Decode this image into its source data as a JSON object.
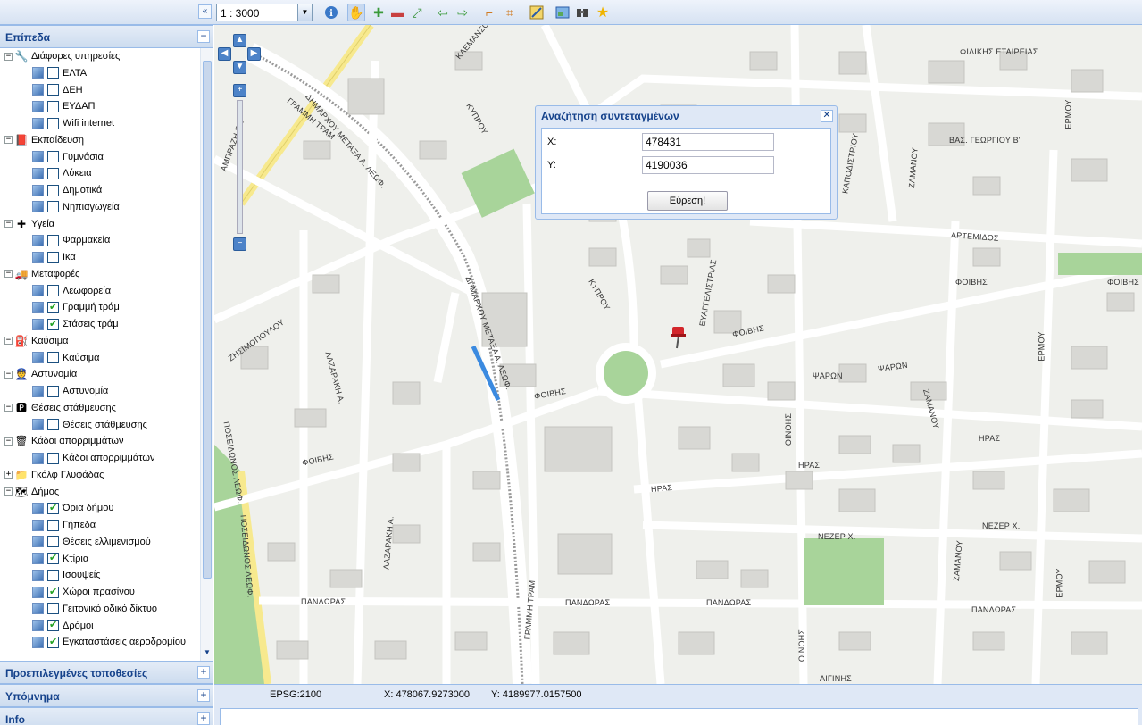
{
  "toolbar": {
    "scale_value": "1 : 3000",
    "icons": [
      "collapse-left-icon",
      "info-icon",
      "pan-hand-icon",
      "zoom-in-icon",
      "zoom-out-icon",
      "full-extent-icon",
      "back-arrow-icon",
      "forward-arrow-icon",
      "measure-distance-icon",
      "measure-area-icon",
      "find-coordinates-icon",
      "print-map-icon",
      "binoculars-icon",
      "bookmark-star-icon"
    ]
  },
  "panels": {
    "layers_title": "Επίπεδα",
    "presets_title": "Προεπιλεγμένες τοποθεσίες",
    "legend_title": "Υπόμνημα",
    "info_title": "Info"
  },
  "tree": [
    {
      "level": 0,
      "label": "Διάφορες υπηρεσίες",
      "expanded": true,
      "icon": "services-icon"
    },
    {
      "level": 1,
      "label": "ΕΛΤΑ",
      "checked": false
    },
    {
      "level": 1,
      "label": "ΔΕΗ",
      "checked": false
    },
    {
      "level": 1,
      "label": "ΕΥΔΑΠ",
      "checked": false
    },
    {
      "level": 1,
      "label": "Wifi internet",
      "checked": false
    },
    {
      "level": 0,
      "label": "Εκπαίδευση",
      "expanded": true,
      "icon": "education-icon"
    },
    {
      "level": 1,
      "label": "Γυμνάσια",
      "checked": false
    },
    {
      "level": 1,
      "label": "Λύκεια",
      "checked": false
    },
    {
      "level": 1,
      "label": "Δημοτικά",
      "checked": false
    },
    {
      "level": 1,
      "label": "Νηπιαγωγεία",
      "checked": false
    },
    {
      "level": 0,
      "label": "Υγεία",
      "expanded": true,
      "icon": "health-icon"
    },
    {
      "level": 1,
      "label": "Φαρμακεία",
      "checked": false
    },
    {
      "level": 1,
      "label": "Ικα",
      "checked": false
    },
    {
      "level": 0,
      "label": "Μεταφορές",
      "expanded": true,
      "icon": "transport-icon"
    },
    {
      "level": 1,
      "label": "Λεωφορεία",
      "checked": false
    },
    {
      "level": 1,
      "label": "Γραμμή τράμ",
      "checked": true
    },
    {
      "level": 1,
      "label": "Στάσεις τράμ",
      "checked": true
    },
    {
      "level": 0,
      "label": "Καύσιμα",
      "expanded": true,
      "icon": "fuel-icon"
    },
    {
      "level": 1,
      "label": "Καύσιμα",
      "checked": false
    },
    {
      "level": 0,
      "label": "Αστυνομία",
      "expanded": true,
      "icon": "police-icon"
    },
    {
      "level": 1,
      "label": "Αστυνομία",
      "checked": false
    },
    {
      "level": 0,
      "label": "Θέσεις στάθμευσης",
      "expanded": true,
      "icon": "parking-icon"
    },
    {
      "level": 1,
      "label": "Θέσεις στάθμευσης",
      "checked": false
    },
    {
      "level": 0,
      "label": "Κάδοι απορριμμάτων",
      "expanded": true,
      "icon": "trash-bin-icon"
    },
    {
      "level": 1,
      "label": "Κάδοι απορριμμάτων",
      "checked": false
    },
    {
      "level": 0,
      "label": "Γκόλφ Γλυφάδας",
      "expanded": false,
      "icon": "folder-icon"
    },
    {
      "level": 0,
      "label": "Δήμος",
      "expanded": true,
      "icon": "municipality-icon"
    },
    {
      "level": 1,
      "label": "Όρια δήμου",
      "checked": true
    },
    {
      "level": 1,
      "label": "Γήπεδα",
      "checked": false
    },
    {
      "level": 1,
      "label": "Θέσεις ελλιμενισμού",
      "checked": false
    },
    {
      "level": 1,
      "label": "Κτίρια",
      "checked": true
    },
    {
      "level": 1,
      "label": "Ισουψείς",
      "checked": false
    },
    {
      "level": 1,
      "label": "Χώροι πρασίνου",
      "checked": true
    },
    {
      "level": 1,
      "label": "Γειτονικό οδικό δίκτυο",
      "checked": false
    },
    {
      "level": 1,
      "label": "Δρόμοι",
      "checked": true
    },
    {
      "level": 1,
      "label": "Εγκαταστάσεις αεροδρομίου",
      "checked": true
    }
  ],
  "dialog": {
    "title": "Αναζήτηση συντεταγμένων",
    "x_label": "X:",
    "x_value": "478431",
    "y_label": "Y:",
    "y_value": "4190036",
    "find_label": "Εύρεση!"
  },
  "status": {
    "epsg": "EPSG:2100",
    "x": "X: 478067.9273000",
    "y": "Y: 4189977.0157500"
  },
  "streets": {
    "klemanso": "ΚΛΕΜΑΝΣΟ",
    "kyprou1": "ΚΥΠΡΟΥ",
    "kyprou2": "ΚΥΠΡΟΥ",
    "filikis": "ΦΙΛΙΚΗΣ ΕΤΑΙΡΕΙΑΣ",
    "ermou1": "ΕΡΜΟΥ",
    "ermou2": "ΕΡΜΟΥ",
    "ermou3": "ΕΡΜΟΥ",
    "vas_georgiou": "ΒΑΣ. ΓΕΩΡΓΙΟΥ Β'",
    "kapodistriou": "ΚΑΠΟΔΙΣΤΡΙΟΥ",
    "zamanou1": "ΖΑΜΑΝΟΥ",
    "zamanou2": "ΖΑΜΑΝΟΥ",
    "zamanou3": "ΖΑΜΑΝΟΥ",
    "artemidos": "ΑΡΤΕΜΙΔΟΣ",
    "foivis1": "ΦΟΙΒΗΣ",
    "foivis2": "ΦΟΙΒΗΣ",
    "foivis3": "ΦΟΙΒΗΣ",
    "foivis4": "ΦΟΙΒΗΣ",
    "foivis5": "ΦΟΙΒΗΣ",
    "evangelistrias": "ΕΥΑΓΓΕΛΙΣΤΡΙΑΣ",
    "psaron1": "ΨΑΡΩΝ",
    "psaron2": "ΨΑΡΩΝ",
    "iras1": "ΗΡΑΣ",
    "iras2": "ΗΡΑΣ",
    "iras3": "ΗΡΑΣ",
    "oinois1": "ΟΙΝΟΗΣ",
    "oinois2": "ΟΙΝΟΗΣ",
    "nezer1": "ΝΕΖΕΡ Χ.",
    "nezer2": "ΝΕΖΕΡ Χ.",
    "pandoras1": "ΠΑΝΔΩΡΑΣ",
    "pandoras2": "ΠΑΝΔΩΡΑΣ",
    "pandoras3": "ΠΑΝΔΩΡΑΣ",
    "pandoras4": "ΠΑΝΔΩΡΑΣ",
    "aiginis": "ΑΙΓΙΝΗΣ",
    "zisimopoulou": "ΖΗΣΙΜΟΠΟΥΛΟΥ",
    "lazaraki1": "ΛΑΖΑΡΑΚΗ Α.",
    "lazaraki2": "ΛΑΖΑΡΑΚΗ Α.",
    "dimarxou1": "ΔΗΜΑΡΧΟΥ ΜΕΤΑΞΑ Α. ΛΕΩΦ.",
    "dimarxou2": "ΔΗΜΑΡΧΟΥ ΜΕΤΑΞΑ Α. ΛΕΩΦ.",
    "grammi_tram1": "ΓΡΑΜΜΗ ΤΡΑΜ",
    "grammi_tram2": "ΓΡΑΜΜΗ ΤΡΑΜ",
    "poseidonos1": "ΠΟΣΕΙΔΩΝΟΣ ΛΕΩΦ.",
    "poseidonos2": "ΠΟΣΕΙΔΩΝΟΣ ΛΕΩΦ.",
    "amprazi": "ΑΜΠΡΑΖΗ ΓΡ."
  }
}
